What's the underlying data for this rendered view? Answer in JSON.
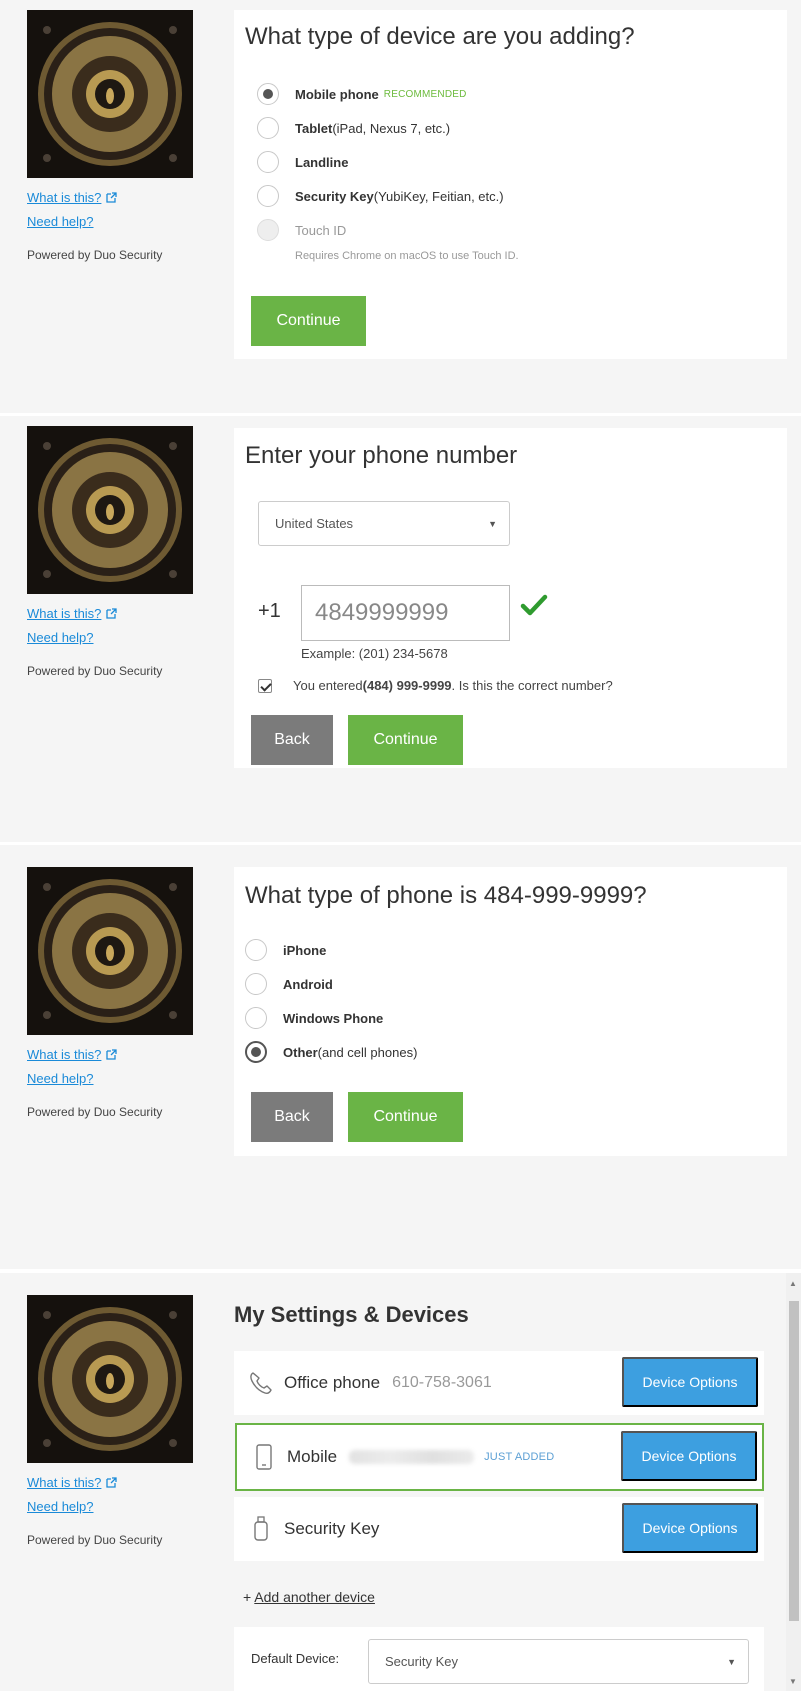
{
  "sidebar": {
    "what_is_this": "What is this?",
    "need_help": "Need help?",
    "powered_by": "Powered by Duo Security",
    "logo_icon": "lehigh-university-seal"
  },
  "device_type": {
    "title": "What type of device are you adding?",
    "options": [
      {
        "label": "Mobile phone",
        "hint": "",
        "badge": "RECOMMENDED",
        "selected": true
      },
      {
        "label": "Tablet",
        "hint": " (iPad, Nexus 7, etc.)",
        "selected": false
      },
      {
        "label": "Landline",
        "hint": "",
        "selected": false
      },
      {
        "label": "Security Key",
        "hint": " (YubiKey, Feitian, etc.)",
        "selected": false
      },
      {
        "label": "Touch ID",
        "hint": "",
        "selected": false,
        "disabled": true
      }
    ],
    "touch_id_note": "Requires Chrome on macOS to use Touch ID.",
    "continue_label": "Continue"
  },
  "phone_entry": {
    "title": "Enter your phone number",
    "country": "United States",
    "prefix": "+1",
    "phone_value": "4849999999",
    "example": "Example: (201) 234-5678",
    "confirm_before": "You entered ",
    "confirm_number": "(484) 999-9999",
    "confirm_after": ". Is this the correct number?",
    "back_label": "Back",
    "continue_label": "Continue"
  },
  "phone_type": {
    "title": "What type of phone is 484-999-9999?",
    "options": [
      {
        "label": "iPhone",
        "hint": "",
        "selected": false
      },
      {
        "label": "Android",
        "hint": "",
        "selected": false
      },
      {
        "label": "Windows Phone",
        "hint": "",
        "selected": false
      },
      {
        "label": "Other",
        "hint": " (and cell phones)",
        "selected": true
      }
    ],
    "back_label": "Back",
    "continue_label": "Continue"
  },
  "settings": {
    "title": "My Settings & Devices",
    "devices": [
      {
        "name": "Office phone",
        "number": "610-758-3061",
        "button": "Device Options",
        "icon": "phone-handset-icon"
      },
      {
        "name": "Mobile",
        "status": "JUST ADDED",
        "button": "Device Options",
        "icon": "mobile-phone-icon"
      },
      {
        "name": "Security Key",
        "button": "Device Options",
        "icon": "usb-key-icon"
      }
    ],
    "add_prefix": "+ ",
    "add_link": "Add another device",
    "default_label": "Default Device:",
    "default_value": "Security Key"
  },
  "colors": {
    "primary_green": "#6ab446",
    "device_button_blue": "#3d9fe0",
    "link_blue": "#1a8ad8",
    "back_gray": "#7b7b7b"
  }
}
